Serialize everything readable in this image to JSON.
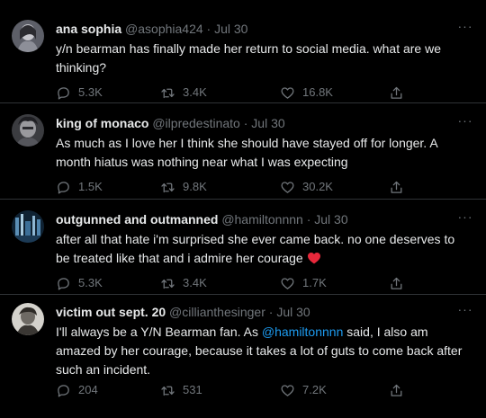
{
  "tweets": [
    {
      "name": "ana sophia",
      "handle": "@asophia424",
      "dot": "·",
      "date": "Jul 30",
      "text": "y/n bearman has finally made her return to social media. what are we thinking?",
      "replies": "5.3K",
      "retweets": "3.4K",
      "likes": "16.8K"
    },
    {
      "name": "king of monaco",
      "handle": "@ilpredestinato",
      "dot": "·",
      "date": "Jul 30",
      "text": "As much as I love her I think she should have stayed off for longer. A month hiatus was nothing near what I was expecting",
      "replies": "1.5K",
      "retweets": "9.8K",
      "likes": "30.2K"
    },
    {
      "name": "outgunned and outmanned",
      "handle": "@hamiltonnnn",
      "dot": "·",
      "date": "Jul 30",
      "text": "after all that hate i'm surprised she ever came back. no one deserves to be treated like that and i admire her courage",
      "emoji": "red-heart",
      "replies": "5.3K",
      "retweets": "3.4K",
      "likes": "1.7K"
    },
    {
      "name": "victim out sept. 20",
      "handle": "@cillianthesinger",
      "dot": "·",
      "date": "Jul 30",
      "text_before": "I'll always be a Y/N Bearman fan. As ",
      "mention": "@hamiltonnnn",
      "text_after": " said, I also am amazed by her courage, because it takes a lot of guts to come back after such an incident.",
      "replies": "204",
      "retweets": "531",
      "likes": "7.2K"
    }
  ],
  "icons": {
    "more": "more-horizontal-icon",
    "reply": "reply-icon",
    "retweet": "retweet-icon",
    "like": "like-icon",
    "share": "share-icon"
  },
  "colors": {
    "background": "#000000",
    "text": "#e7e9ea",
    "muted": "#71767b",
    "link": "#1d9bf0",
    "heart": "#e8283b"
  }
}
